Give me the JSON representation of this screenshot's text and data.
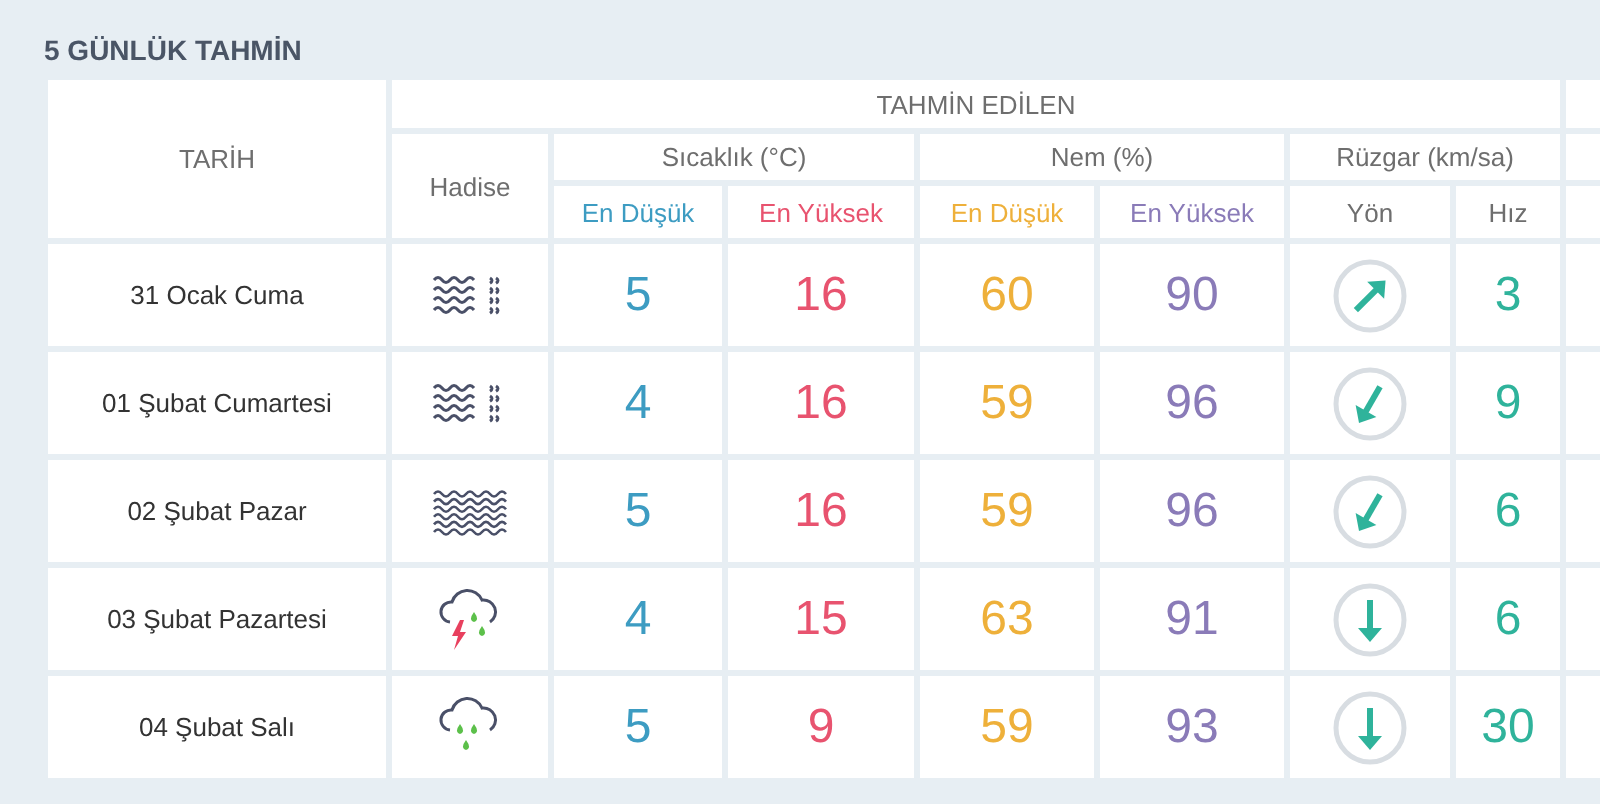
{
  "title": "5 GÜNLÜK TAHMİN",
  "header": {
    "date": "TARİH",
    "forecast": "TAHMİN EDİLEN",
    "event": "Hadise",
    "temperature": "Sıcaklık (°C)",
    "humidity": "Nem (%)",
    "wind": "Rüzgar (km/sa)",
    "temp_low": "En Düşük",
    "temp_high": "En Yüksek",
    "hum_low": "En Düşük",
    "hum_high": "En Yüksek",
    "direction": "Yön",
    "speed": "Hız"
  },
  "rows": [
    {
      "date": "31 Ocak Cuma",
      "weather": {
        "kind": "mist"
      },
      "temp_low": "5",
      "temp_high": "16",
      "hum_low": "60",
      "hum_high": "90",
      "wind_arrow": {
        "kind": "northeast"
      },
      "wind_speed": "3"
    },
    {
      "date": "01 Şubat Cumartesi",
      "weather": {
        "kind": "mist"
      },
      "temp_low": "4",
      "temp_high": "16",
      "hum_low": "59",
      "hum_high": "96",
      "wind_arrow": {
        "kind": "southwest"
      },
      "wind_speed": "9"
    },
    {
      "date": "02 Şubat Pazar",
      "weather": {
        "kind": "fog"
      },
      "temp_low": "5",
      "temp_high": "16",
      "hum_low": "59",
      "hum_high": "96",
      "wind_arrow": {
        "kind": "southwest"
      },
      "wind_speed": "6"
    },
    {
      "date": "03 Şubat Pazartesi",
      "weather": {
        "kind": "thunderstorm"
      },
      "temp_low": "4",
      "temp_high": "15",
      "hum_low": "63",
      "hum_high": "91",
      "wind_arrow": {
        "kind": "south"
      },
      "wind_speed": "6"
    },
    {
      "date": "04 Şubat Salı",
      "weather": {
        "kind": "rain"
      },
      "temp_low": "5",
      "temp_high": "9",
      "hum_low": "59",
      "hum_high": "93",
      "wind_arrow": {
        "kind": "south"
      },
      "wind_speed": "30"
    }
  ]
}
